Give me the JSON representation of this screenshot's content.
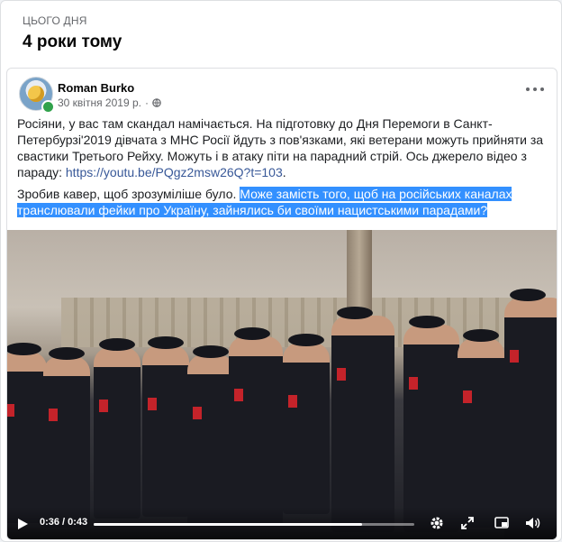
{
  "memory": {
    "kicker": "ЦЬОГО ДНЯ",
    "title": "4 роки тому"
  },
  "post": {
    "author": "Roman Burko",
    "date": "30 квітня 2019 р.",
    "date_separator": "·",
    "paragraph1": "Росіяни, у вас там скандал намічається. На підготовку до Дня Перемоги в Санкт-Петербурзі'2019 дівчата з МНС Росії йдуть з пов'язками, які ветерани можуть прийняти за свастики Третього Рейху. Можуть і в атаку піти на парадний стрій. Ось джерело відео з параду: ",
    "link": "https://youtu.be/PQgz2msw26Q?t=103",
    "paragraph2_plain": "Зробив кавер, щоб зрозуміліше було. ",
    "paragraph2_highlight": "Може замість того, щоб на російських каналах транслювали фейки про Україну, зайнялись би своїми нацистськими парадами?"
  },
  "video": {
    "current_time": "0:36",
    "separator": "/",
    "duration": "0:43",
    "progress": 0.837
  },
  "icons": {
    "globe": "globe-icon",
    "more": "more-options-icon",
    "play": "play-icon",
    "settings": "gear-icon",
    "expand": "expand-icon",
    "pip": "picture-in-picture-icon",
    "volume": "volume-icon"
  },
  "colors": {
    "link": "#385898",
    "highlight": "#3390ff",
    "online": "#31a24c"
  }
}
